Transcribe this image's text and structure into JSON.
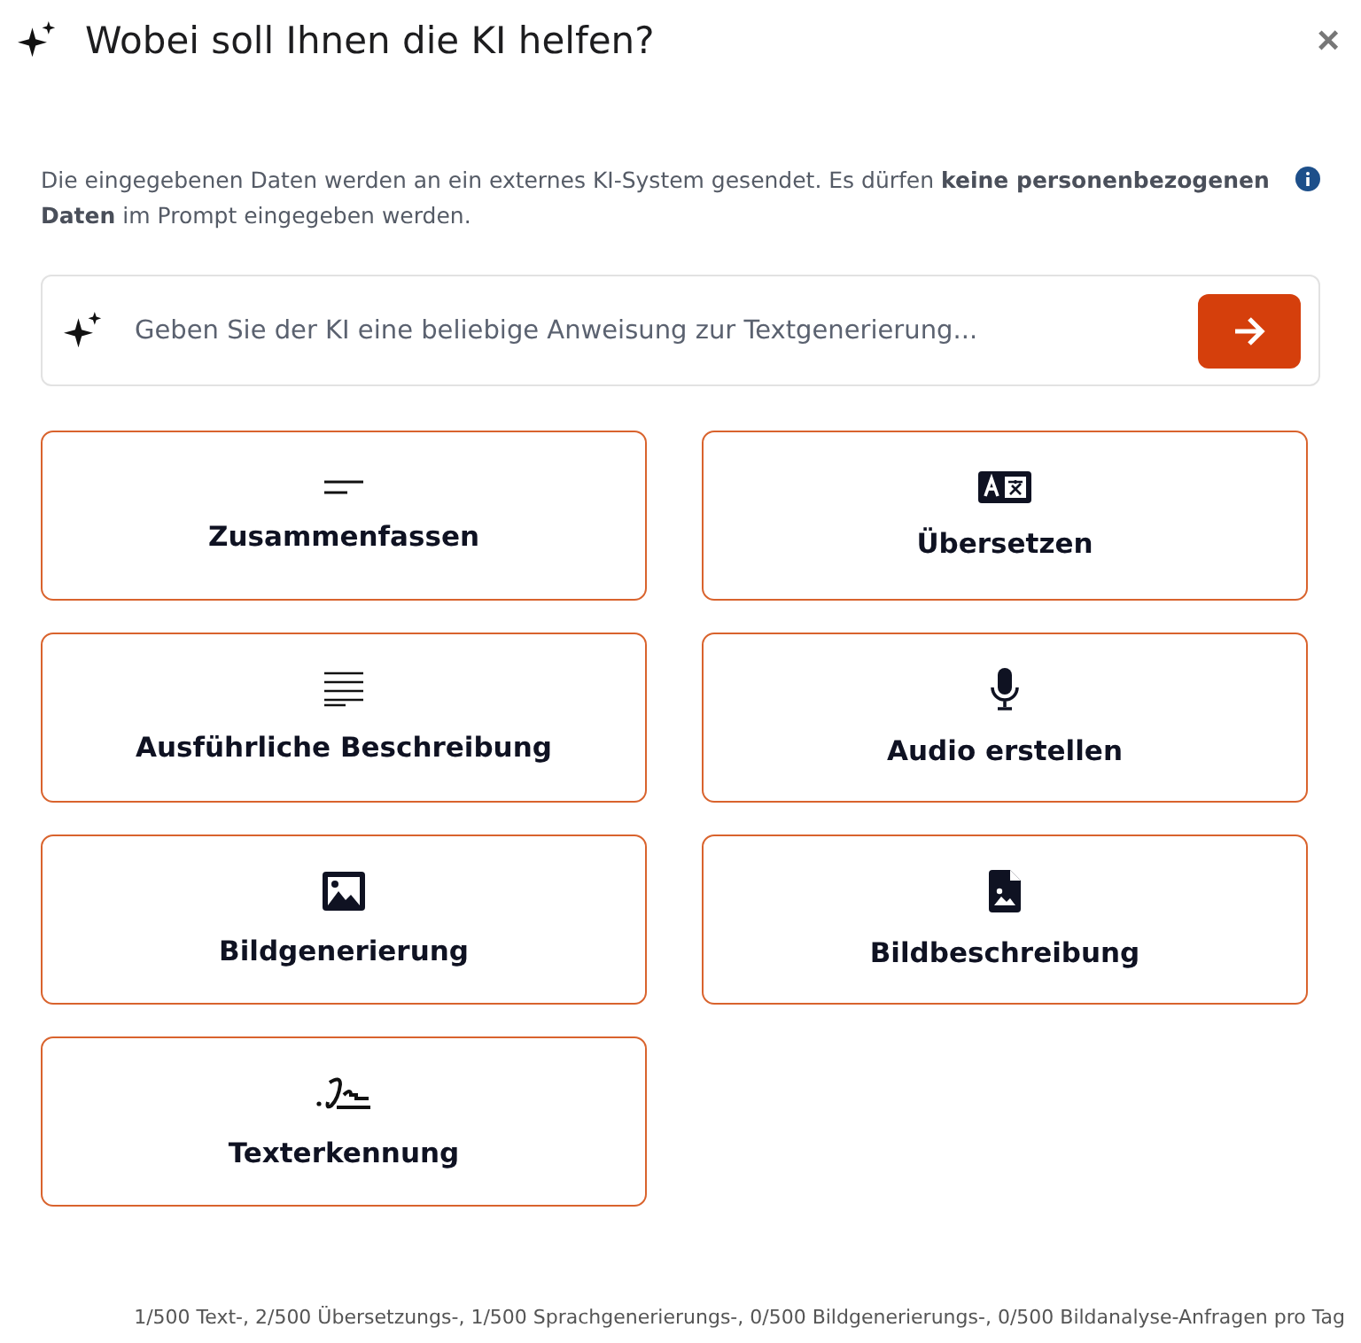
{
  "dialog": {
    "title": "Wobei soll Ihnen die KI helfen?",
    "close": "×"
  },
  "notice": "Die eingegebenen Daten werden an ein externes KI-System gesendet. Es dürfen **keine personenbezogenen Daten** im Prompt eingegeben werden.",
  "prompt": {
    "placeholder": "Geben Sie der KI eine beliebige Anweisung zur Textgenerierung..."
  },
  "actions": [
    {
      "kind": "summary",
      "label": "Zusammenfassen"
    },
    {
      "kind": "translate",
      "label": "Übersetzen"
    },
    {
      "kind": "description",
      "label": "Ausführliche Beschreibung"
    },
    {
      "kind": "audio",
      "label": "Audio erstellen"
    },
    {
      "kind": "image",
      "label": "Bildgenerierung"
    },
    {
      "kind": "imagefile",
      "label": "Bildbeschreibung"
    },
    {
      "kind": "signature",
      "label": "Texterkennung"
    }
  ],
  "quota": "1/500 Text-, 2/500 Übersetzungs-, 1/500 Sprachgenerierungs-, 0/500 Bildgenerierungs-, 0/500 Bildanalyse-Anfragen pro Tag"
}
